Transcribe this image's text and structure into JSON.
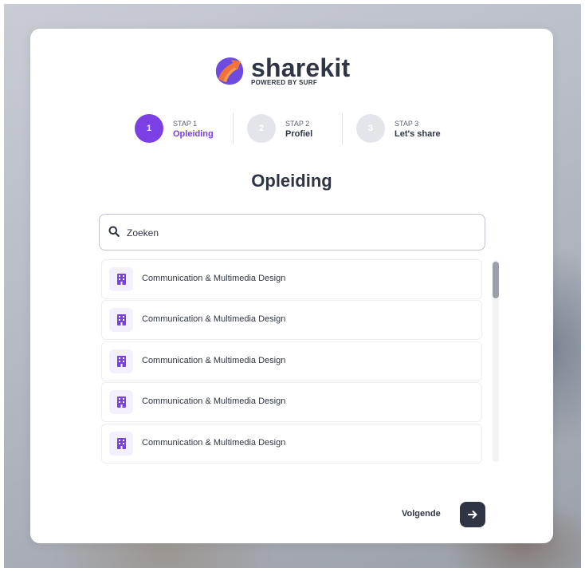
{
  "brand": {
    "name": "sharekit",
    "tagline": "POWERED BY SURF",
    "colors": {
      "primary": "#7b3fe4",
      "dark": "#2f3545",
      "logo_orange": "#f2733a",
      "logo_purple": "#6e4be0"
    }
  },
  "stepper": [
    {
      "number": "1",
      "label": "STAP 1",
      "name": "Opleiding",
      "state": "active"
    },
    {
      "number": "2",
      "label": "STAP 2",
      "name": "Profiel",
      "state": "inactive"
    },
    {
      "number": "3",
      "label": "STAP 3",
      "name": "Let's share",
      "state": "inactive"
    }
  ],
  "title": "Opleiding",
  "search": {
    "placeholder": "Zoeken",
    "value": "",
    "icon": "search-icon"
  },
  "list": {
    "item_icon": "building-icon",
    "items": [
      {
        "label": "Communication & Multimedia Design"
      },
      {
        "label": "Communication & Multimedia Design"
      },
      {
        "label": "Communication & Multimedia Design"
      },
      {
        "label": "Communication & Multimedia Design"
      },
      {
        "label": "Communication & Multimedia Design"
      }
    ]
  },
  "footer": {
    "next_label": "Volgende",
    "next_icon": "arrow-right-icon"
  }
}
